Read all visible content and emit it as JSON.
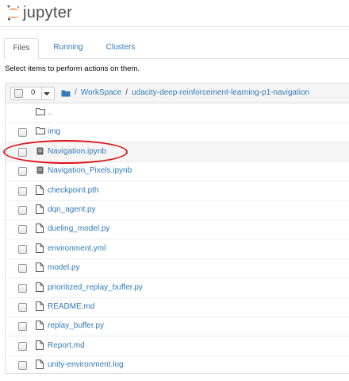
{
  "header": {
    "logo_text": "jupyter"
  },
  "tabs": [
    {
      "label": "Files",
      "active": true
    },
    {
      "label": "Running",
      "active": false
    },
    {
      "label": "Clusters",
      "active": false
    }
  ],
  "instructions": "Select items to perform actions on them.",
  "toolbar": {
    "selected_count": "0"
  },
  "breadcrumb": {
    "root_sep": "/",
    "items": [
      "WorkSpace",
      "udacity-deep-reinforcement-learning-p1-navigation"
    ],
    "sep": "/"
  },
  "files": [
    {
      "name": "..",
      "type": "folder",
      "checkbox": false
    },
    {
      "name": "img",
      "type": "folder",
      "checkbox": true
    },
    {
      "name": "Navigation.ipynb",
      "type": "notebook",
      "checkbox": true,
      "highlighted": true
    },
    {
      "name": "Navigation_Pixels.ipynb",
      "type": "notebook",
      "checkbox": true
    },
    {
      "name": "checkpoint.pth",
      "type": "file",
      "checkbox": true
    },
    {
      "name": "dqn_agent.py",
      "type": "file",
      "checkbox": true
    },
    {
      "name": "dueling_model.py",
      "type": "file",
      "checkbox": true
    },
    {
      "name": "environment.yml",
      "type": "file",
      "checkbox": true
    },
    {
      "name": "model.py",
      "type": "file",
      "checkbox": true
    },
    {
      "name": "prioritized_replay_buffer.py",
      "type": "file",
      "checkbox": true
    },
    {
      "name": "README.md",
      "type": "file",
      "checkbox": true
    },
    {
      "name": "replay_buffer.py",
      "type": "file",
      "checkbox": true
    },
    {
      "name": "Report.md",
      "type": "file",
      "checkbox": true
    },
    {
      "name": "unity-environment.log",
      "type": "file",
      "checkbox": true
    }
  ],
  "colors": {
    "link": "#337ab7",
    "jupyter_orange": "#f37726",
    "annotation_red": "#e0121c"
  }
}
